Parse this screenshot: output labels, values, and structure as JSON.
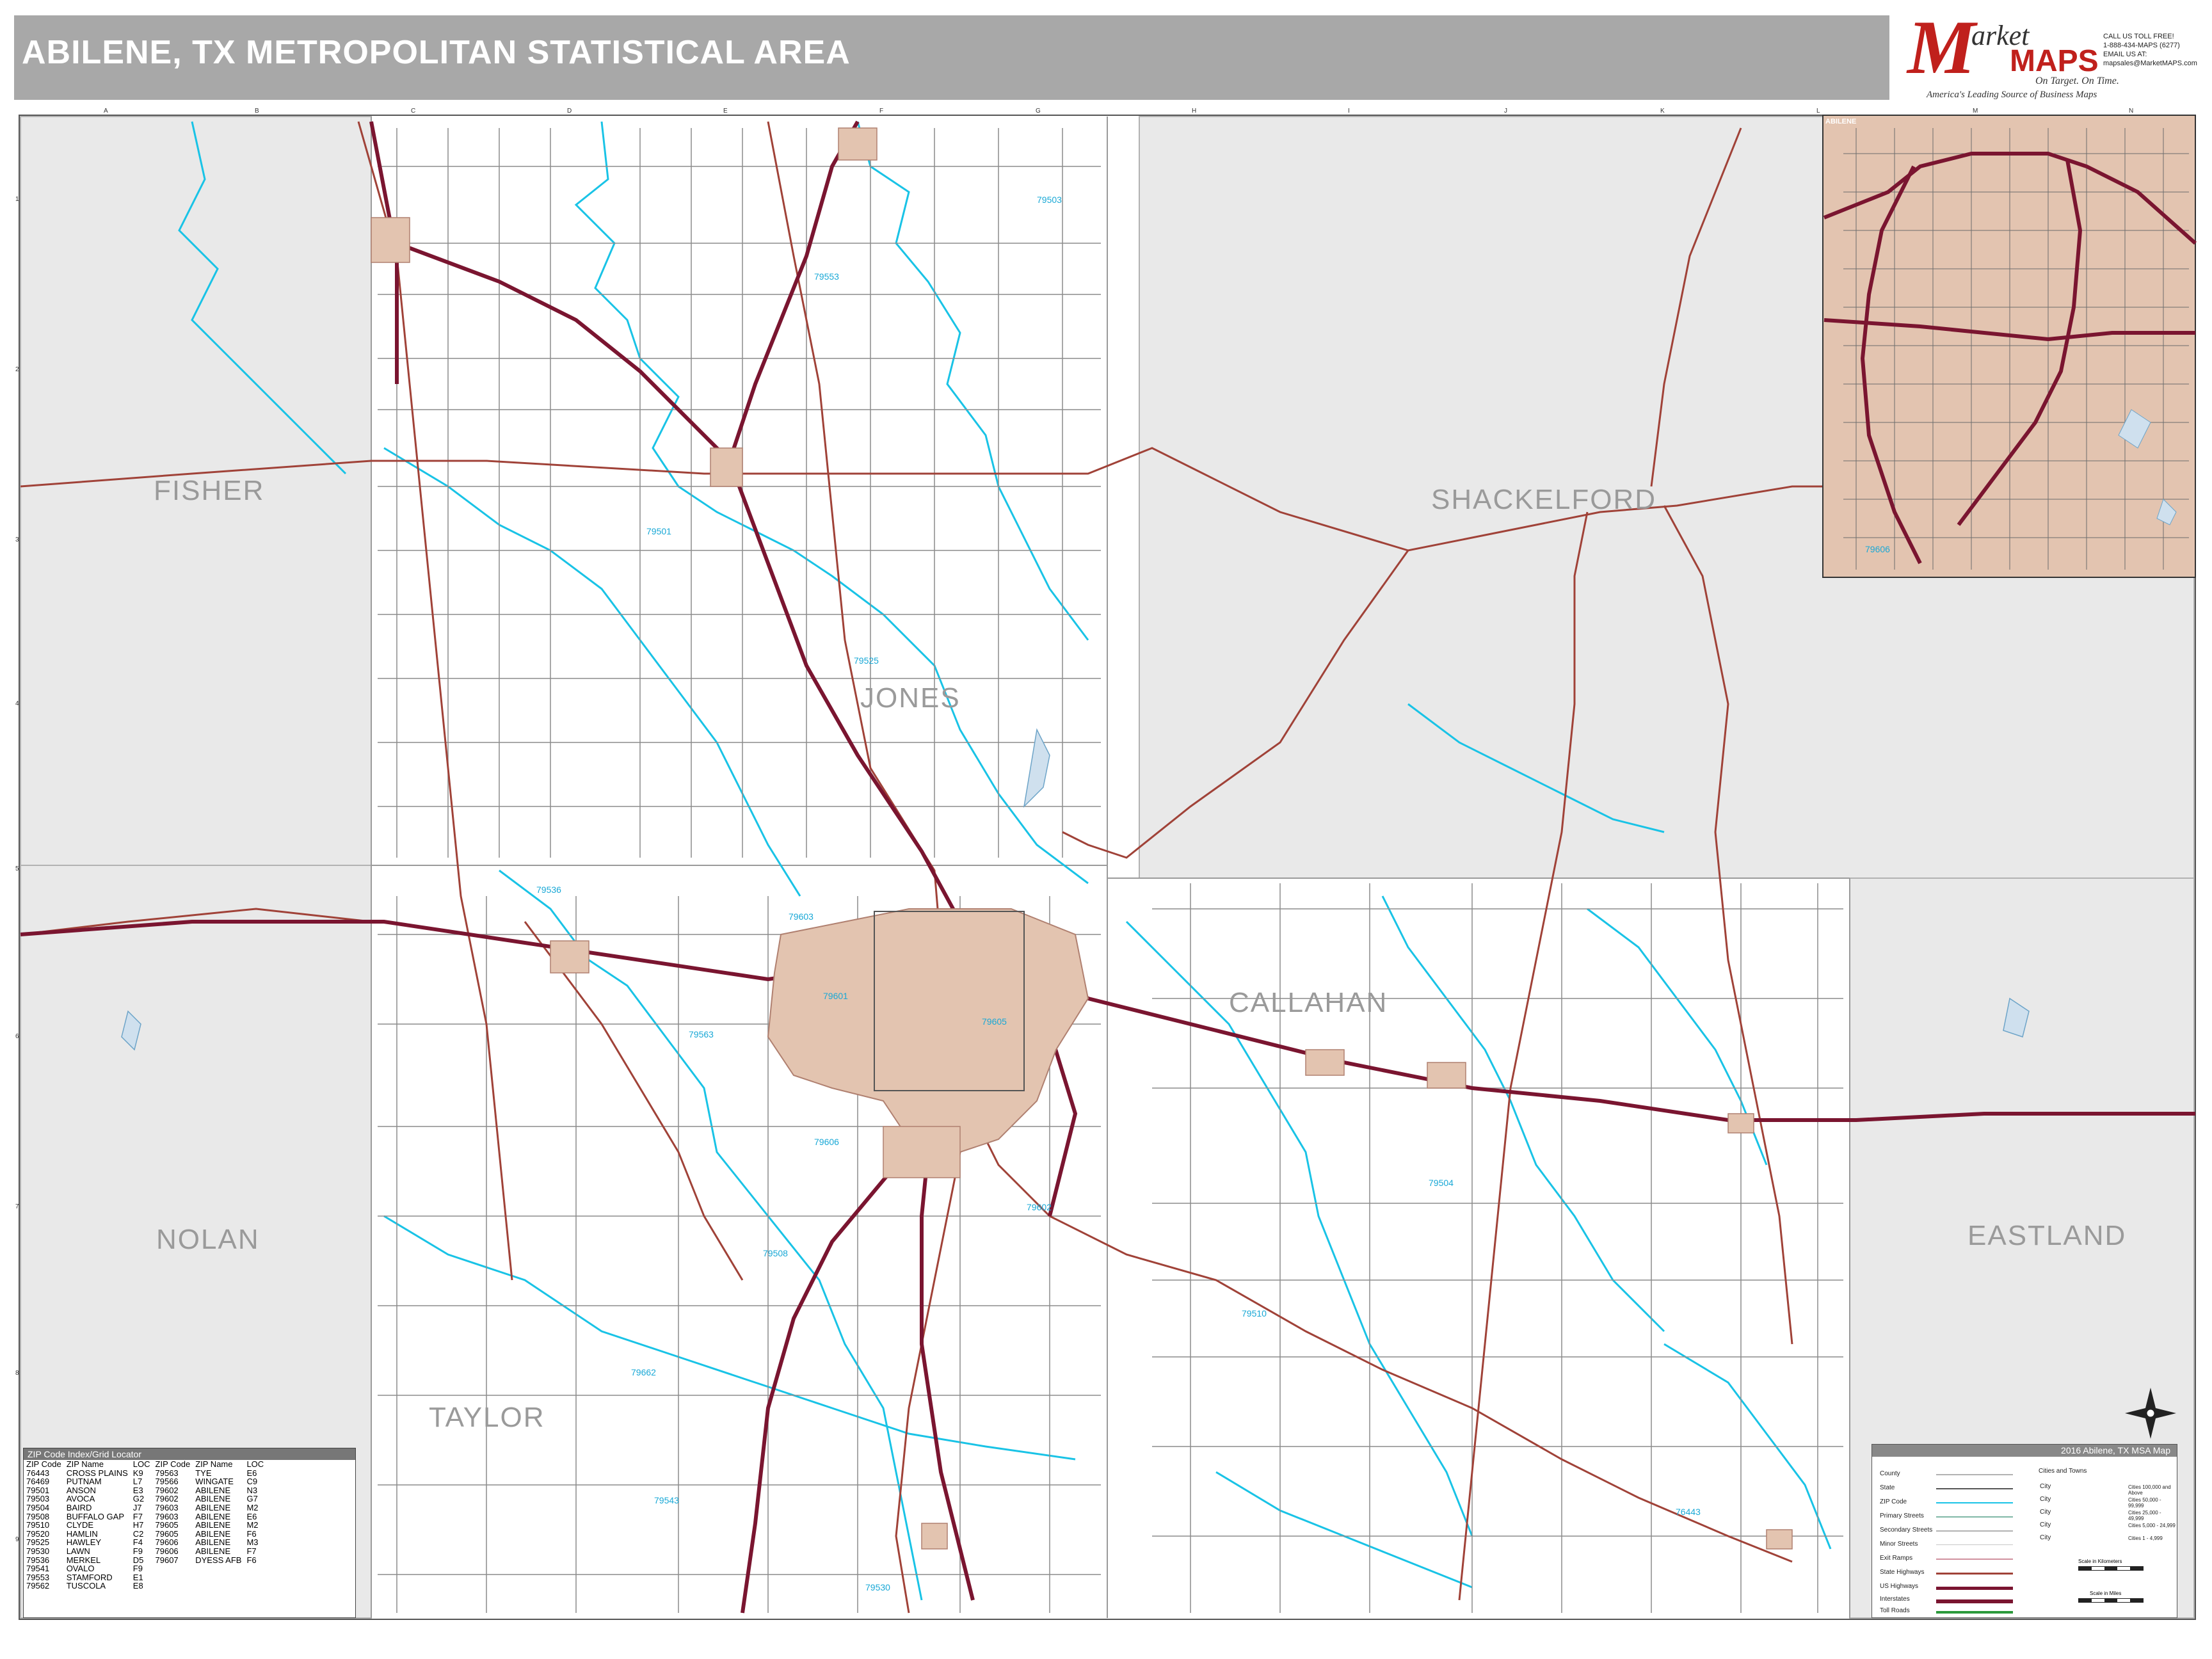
{
  "title": "ABILENE, TX METROPOLITAN STATISTICAL AREA",
  "logo": {
    "brand_m": "M",
    "brand_rest": "arket",
    "brand_maps": "MAPS",
    "tagline": "On Target. On Time.",
    "subtitle": "America's Leading Source of Business Maps",
    "contact": [
      "CALL US TOLL FREE!",
      "1-888-434-MAPS (6277)",
      "EMAIL US AT:",
      "mapsales@MarketMAPS.com"
    ]
  },
  "counties": [
    "FISHER",
    "SHACKELFORD",
    "JONES",
    "CALLAHAN",
    "NOLAN",
    "TAYLOR",
    "EASTLAND"
  ],
  "inset_title": "ABILENE",
  "grid": {
    "columns": [
      "A",
      "B",
      "C",
      "D",
      "E",
      "F",
      "G",
      "H",
      "I",
      "J",
      "K",
      "L",
      "M",
      "N"
    ],
    "rows": [
      "1",
      "2",
      "3",
      "4",
      "5",
      "6",
      "7",
      "8",
      "9"
    ]
  },
  "zip_index": {
    "title": "ZIP Code Index/Grid Locator",
    "headers": [
      "ZIP Code",
      "ZIP Name",
      "LOC",
      "ZIP Code",
      "ZIP Name",
      "LOC"
    ],
    "left": [
      [
        "76443",
        "CROSS PLAINS",
        "K9"
      ],
      [
        "76469",
        "PUTNAM",
        "L7"
      ],
      [
        "79501",
        "ANSON",
        "E3"
      ],
      [
        "79503",
        "AVOCA",
        "G2"
      ],
      [
        "79504",
        "BAIRD",
        "J7"
      ],
      [
        "79508",
        "BUFFALO GAP",
        "F7"
      ],
      [
        "79510",
        "CLYDE",
        "H7"
      ],
      [
        "79520",
        "HAMLIN",
        "C2"
      ],
      [
        "79525",
        "HAWLEY",
        "F4"
      ],
      [
        "79530",
        "LAWN",
        "F9"
      ],
      [
        "79536",
        "MERKEL",
        "D5"
      ],
      [
        "79541",
        "OVALO",
        "F9"
      ],
      [
        "79553",
        "STAMFORD",
        "E1"
      ],
      [
        "79562",
        "TUSCOLA",
        "E8"
      ]
    ],
    "right": [
      [
        "79563",
        "TYE",
        "E6"
      ],
      [
        "79566",
        "WINGATE",
        "C9"
      ],
      [
        "79602",
        "ABILENE",
        "N3"
      ],
      [
        "79602",
        "ABILENE",
        "G7"
      ],
      [
        "79603",
        "ABILENE",
        "M2"
      ],
      [
        "79603",
        "ABILENE",
        "E6"
      ],
      [
        "79605",
        "ABILENE",
        "M2"
      ],
      [
        "79605",
        "ABILENE",
        "F6"
      ],
      [
        "79606",
        "ABILENE",
        "M3"
      ],
      [
        "79606",
        "ABILENE",
        "F7"
      ],
      [
        "79607",
        "DYESS AFB",
        "F6"
      ]
    ]
  },
  "legend": {
    "title": "2016 Abilene, TX MSA Map",
    "rows": [
      "County",
      "State",
      "ZIP Code",
      "Primary Streets",
      "Secondary Streets",
      "Minor Streets",
      "Exit Ramps",
      "State Highways",
      "US Highways",
      "Interstates",
      "Toll Roads"
    ],
    "cities_header": "Cities and Towns",
    "cities": [
      "City",
      "City",
      "City",
      "City",
      "City"
    ],
    "populations": [
      "Cities 100,000 and Above",
      "Cities 50,000 - 99,999",
      "Cities 25,000 - 49,999",
      "Cities 5,000 - 24,999",
      "Cities 1 - 4,999"
    ],
    "scale_km": "Scale in Kilometers",
    "scale_mi": "Scale in Miles"
  },
  "zip_labels": [
    "79503",
    "79553",
    "79501",
    "79525",
    "79536",
    "79563",
    "79603",
    "79601",
    "79605",
    "79606",
    "79602",
    "79508",
    "79510",
    "79504",
    "79662",
    "79543",
    "79530",
    "76443",
    "79606"
  ],
  "colors": {
    "county_fill": "#e9e9e9",
    "city_fill": "#e3c4b0",
    "interstate": "#7a1530",
    "highway": "#a04238",
    "zip_boundary": "#19c3e6",
    "street": "#8c8c8c"
  }
}
